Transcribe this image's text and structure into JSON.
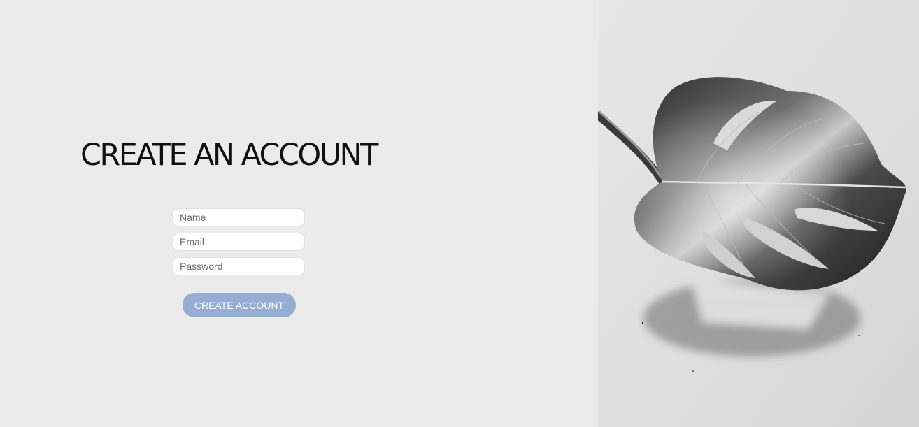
{
  "page": {
    "title": "CREATE AN ACCOUNT"
  },
  "form": {
    "name_placeholder": "Name",
    "email_placeholder": "Email",
    "password_placeholder": "Password",
    "submit_label": "CREATE ACCOUNT"
  },
  "hero": {
    "icon": "monstera-leaf-photo"
  },
  "colors": {
    "background": "#ebebeb",
    "button": "#94add0",
    "button_text": "#ffffff",
    "title": "#111111"
  }
}
